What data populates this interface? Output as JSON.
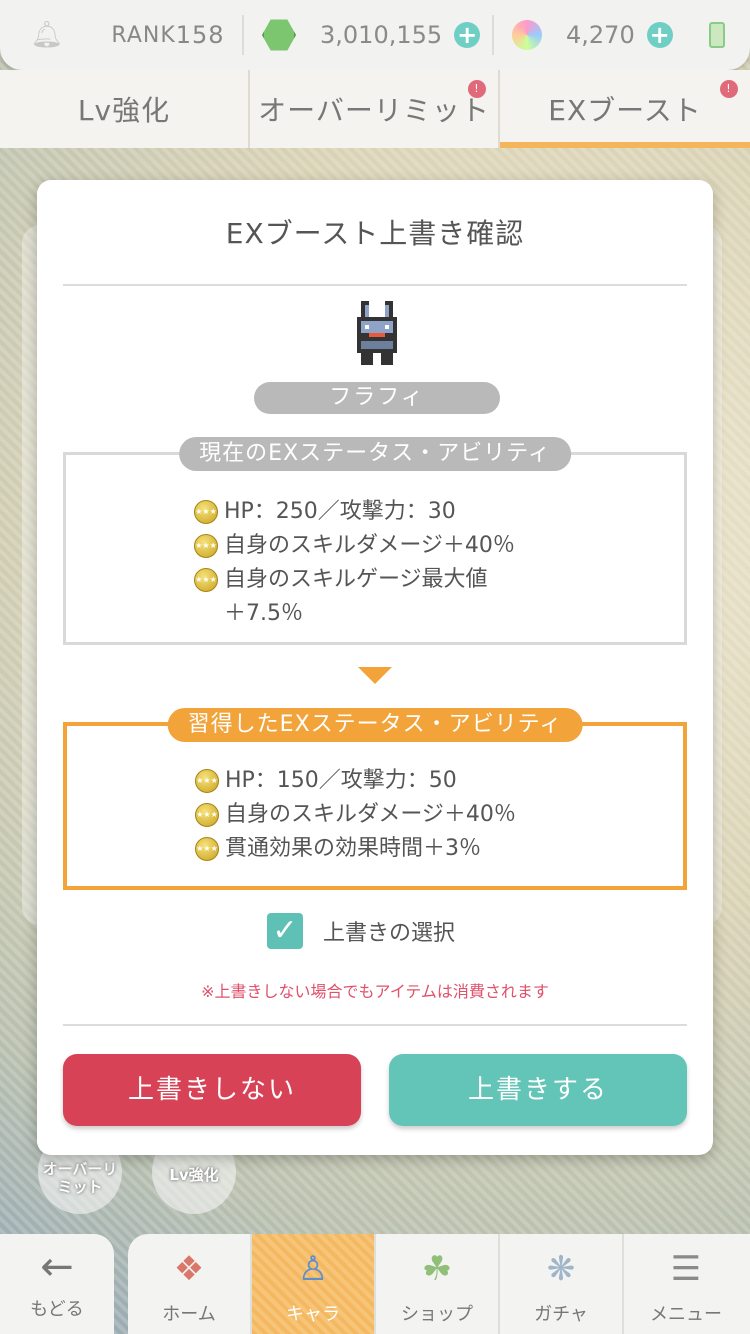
{
  "status_bar": {
    "rank_prefix": "RANK",
    "rank_value": "158",
    "gems": "3,010,155",
    "orbs": "4,270"
  },
  "tabs": [
    {
      "label": "Lv強化"
    },
    {
      "label": "オーバーリミット",
      "badge": "!"
    },
    {
      "label": "EXブースト",
      "badge": "!"
    }
  ],
  "modal": {
    "title": "EXブースト上書き確認",
    "character_name": "フラフィ",
    "current": {
      "label": "現在のEXステータス・アビリティ",
      "stats": [
        "HP：250／攻撃力：30",
        "自身のスキルダメージ＋40％",
        "自身のスキルゲージ最大値＋7.5％"
      ]
    },
    "learned": {
      "label": "習得したEXステータス・アビリティ",
      "stats": [
        "HP：150／攻撃力：50",
        "自身のスキルダメージ＋40％",
        "貫通効果の効果時間＋3％"
      ]
    },
    "overwrite_checked": true,
    "checkbox_label": "上書きの選択",
    "warning": "※上書きしない場合でもアイテムは消費されます",
    "button_no": "上書きしない",
    "button_yes": "上書きする"
  },
  "side_buttons": {
    "overlimit": "オーバーリミット",
    "lv": "Lv強化"
  },
  "bottom_nav": {
    "back": "もどる",
    "items": [
      {
        "label": "ホーム",
        "icon": "home-icon"
      },
      {
        "label": "キャラ",
        "icon": "character-icon",
        "active": true
      },
      {
        "label": "ショップ",
        "icon": "shop-icon"
      },
      {
        "label": "ガチャ",
        "icon": "gacha-icon"
      },
      {
        "label": "メニュー",
        "icon": "menu-icon"
      }
    ]
  },
  "colors": {
    "accent_orange": "#f2a43a",
    "button_red": "#d84256",
    "button_teal": "#62c5b7",
    "warning_red": "#e0506a"
  }
}
